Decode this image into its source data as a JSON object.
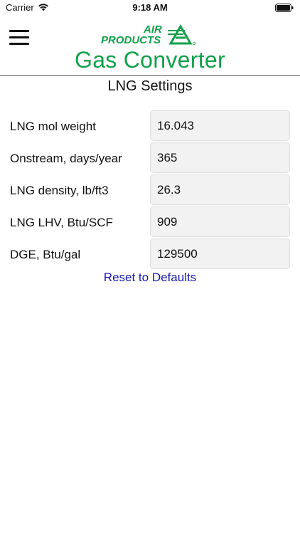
{
  "status_bar": {
    "carrier": "Carrier",
    "time": "9:18 AM",
    "icons": [
      "wifi-icon",
      "battery-icon"
    ]
  },
  "header": {
    "logo_text_top": "AIR",
    "logo_text_bottom": "PRODUCTS",
    "title": "Gas Converter",
    "menu_icon": "menu-icon",
    "brand_color": "#12a04a"
  },
  "page": {
    "heading": "LNG Settings"
  },
  "settings": [
    {
      "label": "LNG mol weight",
      "value": "16.043"
    },
    {
      "label": "Onstream, days/year",
      "value": "365"
    },
    {
      "label": "LNG density, lb/ft3",
      "value": "26.3"
    },
    {
      "label": "LNG LHV, Btu/SCF",
      "value": "909"
    },
    {
      "label": "DGE, Btu/gal",
      "value": "129500"
    }
  ],
  "actions": {
    "reset_label": "Reset to Defaults",
    "link_color": "#1a1aa6"
  }
}
